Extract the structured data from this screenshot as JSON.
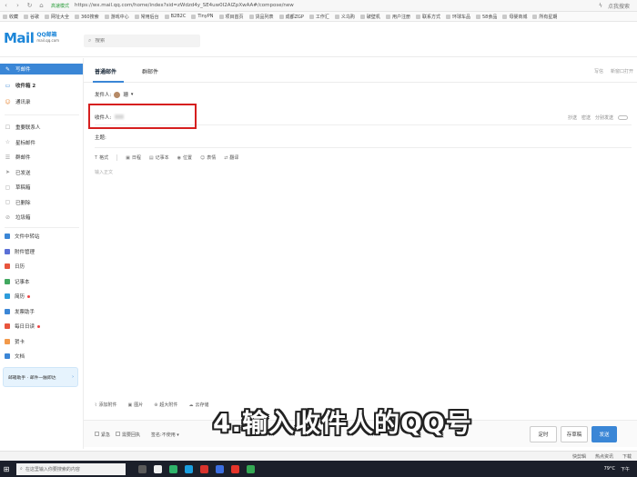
{
  "browser": {
    "security_label": "高速模式",
    "url": "https://wx.mail.qq.com/home/index?sid=zWdzd4y_SE4uw0I2AlZpXwAA#/compose/new",
    "search_label": "点我搜索",
    "bookmarks": [
      "收藏",
      "谷歌",
      "网址大全",
      "360搜索",
      "游戏中心",
      "常用后台",
      "B2B2C",
      "TinyPN",
      "项目首页",
      "货品列表",
      "成都ZGP",
      "工作汇",
      "义乌购",
      "破壁机",
      "用户注册",
      "联系方式",
      "环球车品",
      "58食品",
      "母婴商城",
      "所有星期"
    ]
  },
  "mail_header": {
    "logo_text": "Mail",
    "logo_cn": "QQ邮箱",
    "logo_domain": "mail.qq.com",
    "search_placeholder": "搜索"
  },
  "sidebar": {
    "compose": "写邮件",
    "inbox": "收件箱 2",
    "contacts": "通讯录",
    "folders": [
      "重要联系人",
      "星标邮件",
      "群邮件",
      "已发送",
      "草稿箱",
      "已删除",
      "垃圾箱"
    ],
    "apps": [
      {
        "label": "文件中转站",
        "color": "#3b86d6"
      },
      {
        "label": "附件管理",
        "color": "#5a6fd6"
      },
      {
        "label": "日历",
        "color": "#e8553d"
      },
      {
        "label": "记事本",
        "color": "#41a85f"
      },
      {
        "label": "简历",
        "color": "#2d9cdb"
      },
      {
        "label": "发票助手",
        "color": "#3b86d6"
      },
      {
        "label": "每日日读",
        "color": "#e8553d"
      },
      {
        "label": "贺卡",
        "color": "#f2994a"
      },
      {
        "label": "文档",
        "color": "#3b86d6"
      }
    ],
    "promo": "邮箱助手 · 邮件一触即达"
  },
  "compose": {
    "tab_normal": "普通邮件",
    "tab_group": "群邮件",
    "tab_right": [
      "写信",
      "新窗口打开"
    ],
    "sender_label": "发件人:",
    "sender_name": "珊",
    "to_label": "收件人:",
    "to_right": [
      "抄送",
      "密送",
      "分别发送"
    ],
    "subject_label": "主题:",
    "toolbar": [
      "格式",
      "日程",
      "记事本",
      "位置",
      "表情",
      "翻译"
    ],
    "body_placeholder": "输入正文",
    "attach_tools": [
      "添加附件",
      "图片",
      "超大附件",
      "云存储"
    ],
    "options": [
      "紧急",
      "需要回执"
    ],
    "signature": "签名:不使用",
    "buttons": [
      "定时",
      "存草稿",
      "发送"
    ]
  },
  "caption": "4.输入收件人的QQ号",
  "status": {
    "items": [
      "快剪辑",
      "热点资讯",
      "下载"
    ]
  },
  "taskbar": {
    "search_placeholder": "在这里输入你要搜索的内容",
    "weather": "79°C",
    "clock": "下午"
  }
}
